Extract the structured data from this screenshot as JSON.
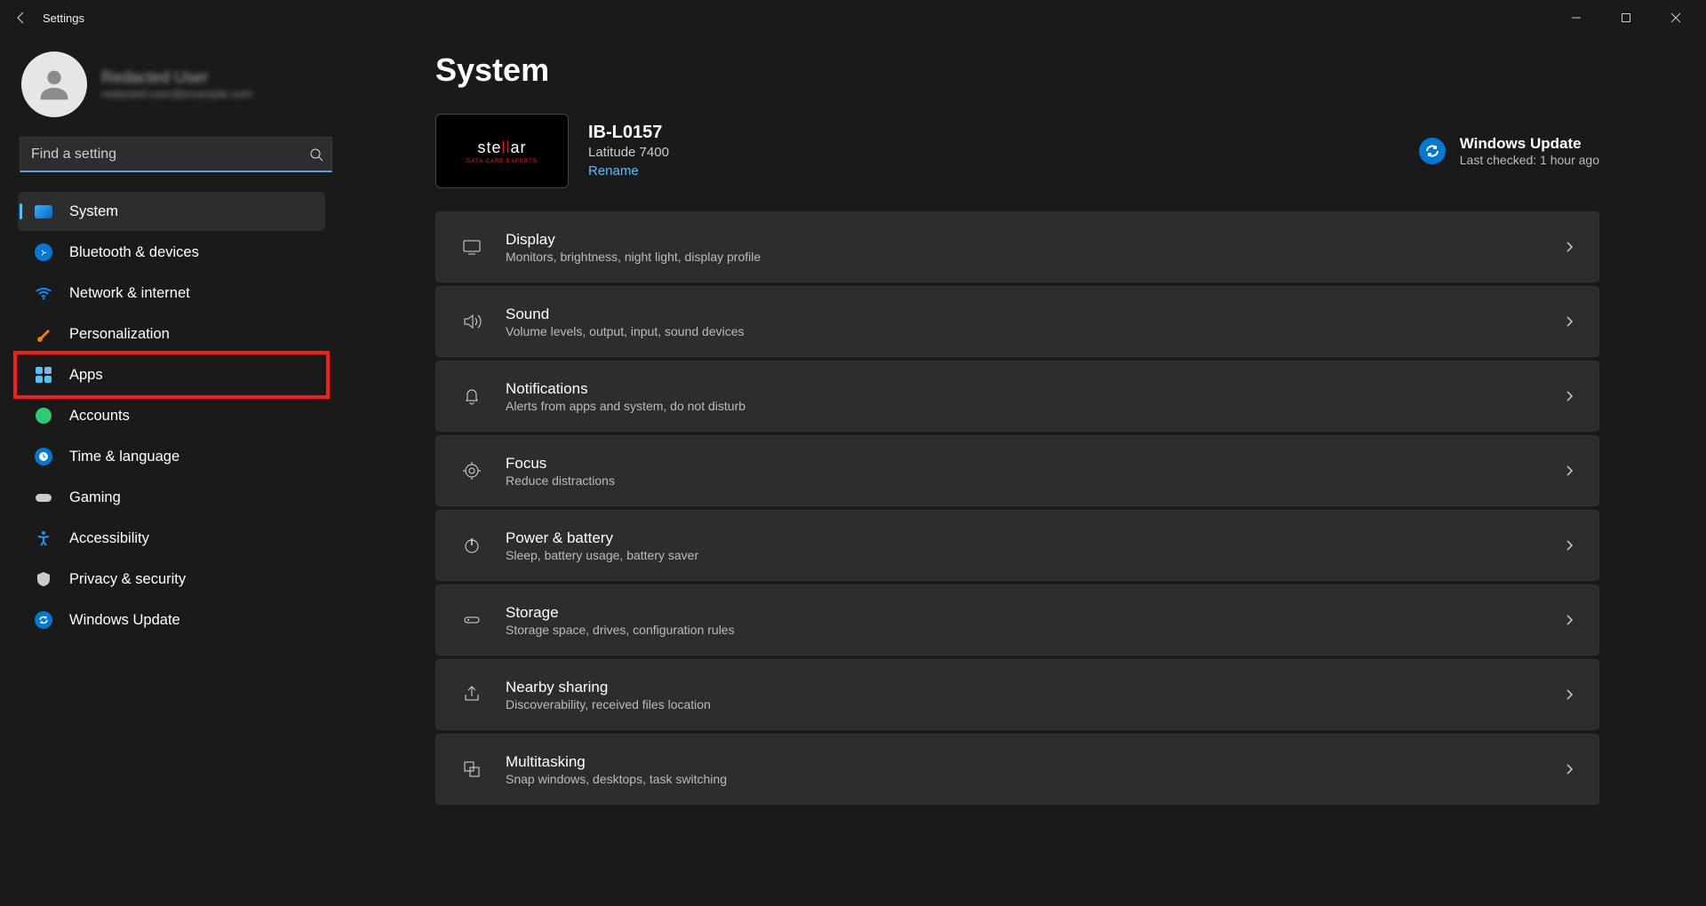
{
  "titlebar": {
    "title": "Settings"
  },
  "user": {
    "name": "Redacted User",
    "email": "redacted.user@example.com"
  },
  "search": {
    "placeholder": "Find a setting"
  },
  "sidebar": {
    "items": [
      {
        "label": "System"
      },
      {
        "label": "Bluetooth & devices"
      },
      {
        "label": "Network & internet"
      },
      {
        "label": "Personalization"
      },
      {
        "label": "Apps"
      },
      {
        "label": "Accounts"
      },
      {
        "label": "Time & language"
      },
      {
        "label": "Gaming"
      },
      {
        "label": "Accessibility"
      },
      {
        "label": "Privacy & security"
      },
      {
        "label": "Windows Update"
      }
    ]
  },
  "page": {
    "title": "System"
  },
  "device": {
    "thumb_text1": "ste",
    "thumb_text2": "ll",
    "thumb_text3": "ar",
    "thumb_sub": "DATA CARE EXPERTS",
    "name": "IB-L0157",
    "model": "Latitude 7400",
    "rename": "Rename"
  },
  "update": {
    "title": "Windows Update",
    "subtitle": "Last checked: 1 hour ago"
  },
  "cards": [
    {
      "title": "Display",
      "desc": "Monitors, brightness, night light, display profile"
    },
    {
      "title": "Sound",
      "desc": "Volume levels, output, input, sound devices"
    },
    {
      "title": "Notifications",
      "desc": "Alerts from apps and system, do not disturb"
    },
    {
      "title": "Focus",
      "desc": "Reduce distractions"
    },
    {
      "title": "Power & battery",
      "desc": "Sleep, battery usage, battery saver"
    },
    {
      "title": "Storage",
      "desc": "Storage space, drives, configuration rules"
    },
    {
      "title": "Nearby sharing",
      "desc": "Discoverability, received files location"
    },
    {
      "title": "Multitasking",
      "desc": "Snap windows, desktops, task switching"
    }
  ]
}
